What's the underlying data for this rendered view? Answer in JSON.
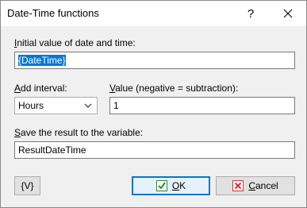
{
  "window": {
    "title": "Date-Time functions",
    "help_glyph": "?"
  },
  "initial": {
    "label_prefix": "",
    "label_accel": "I",
    "label_rest": "nitial value of date and time:",
    "value": "{DateTime}"
  },
  "interval": {
    "label_accel": "A",
    "label_rest": "dd interval:",
    "selected": "Hours"
  },
  "value_field": {
    "label_accel": "V",
    "label_rest": "alue (negative = subtraction):",
    "value": "1"
  },
  "save": {
    "label_accel": "S",
    "label_rest": "ave the result to the variable:",
    "value": "ResultDateTime"
  },
  "buttons": {
    "vars_label": "{V}",
    "ok_accel": "O",
    "ok_rest": "K",
    "cancel_accel": "C",
    "cancel_rest": "ancel"
  },
  "colors": {
    "accent": "#0078d7",
    "ok_icon": "#2e8b2e",
    "cancel_icon": "#d13438"
  },
  "icons": {
    "help": "question-mark-icon",
    "close": "close-x-icon",
    "ok": "checkmark-icon",
    "cancel": "red-x-icon",
    "dropdown": "chevron-down-icon"
  }
}
